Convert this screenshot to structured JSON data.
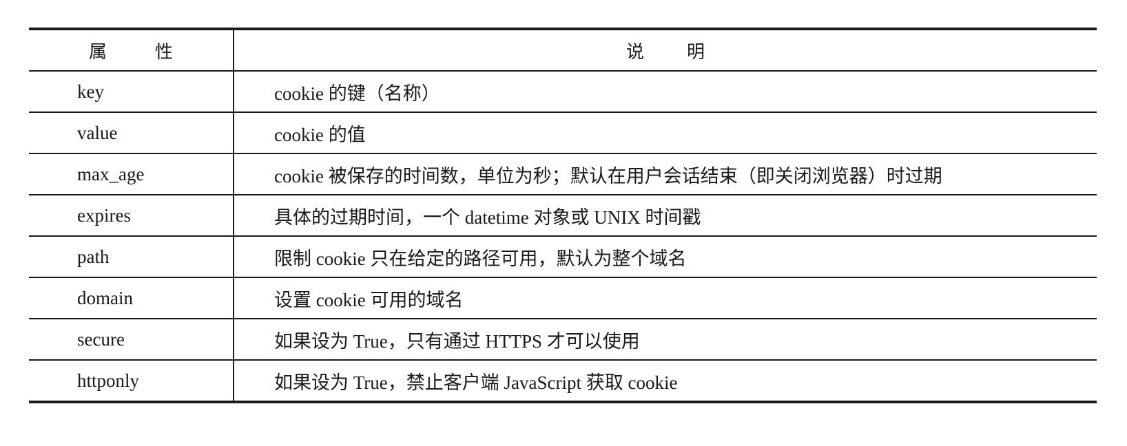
{
  "header": {
    "attr_chars": [
      "属",
      "性"
    ],
    "desc_chars": [
      "说",
      "明"
    ]
  },
  "rows": [
    {
      "attr": "key",
      "desc": "cookie 的键（名称）"
    },
    {
      "attr": "value",
      "desc": "cookie 的值"
    },
    {
      "attr": "max_age",
      "desc": "cookie 被保存的时间数，单位为秒；默认在用户会话结束（即关闭浏览器）时过期"
    },
    {
      "attr": "expires",
      "desc": "具体的过期时间，一个 datetime 对象或 UNIX 时间戳"
    },
    {
      "attr": "path",
      "desc": "限制 cookie 只在给定的路径可用，默认为整个域名"
    },
    {
      "attr": "domain",
      "desc": "设置 cookie 可用的域名"
    },
    {
      "attr": "secure",
      "desc": "如果设为 True，只有通过 HTTPS 才可以使用"
    },
    {
      "attr": "httponly",
      "desc": "如果设为 True，禁止客户端 JavaScript 获取 cookie"
    }
  ]
}
